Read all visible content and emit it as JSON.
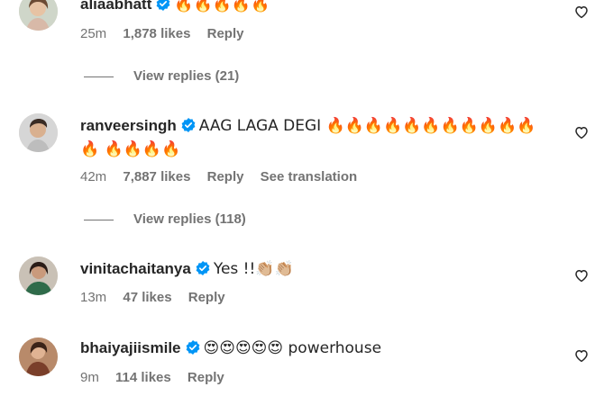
{
  "comments": [
    {
      "username": "aliaabhatt",
      "text": "🔥🔥🔥🔥🔥",
      "time": "25m",
      "likes": "1,878 likes",
      "reply": "Reply",
      "view_replies": "View replies (21)"
    },
    {
      "username": "ranveersingh",
      "text": "AAG LAGA DEGI 🔥🔥🔥🔥🔥🔥🔥🔥🔥🔥🔥🔥 🔥🔥🔥🔥",
      "time": "42m",
      "likes": "7,887 likes",
      "reply": "Reply",
      "translation": "See translation",
      "view_replies": "View replies (118)"
    },
    {
      "username": "vinitachaitanya",
      "text": "Yes !!👏🏼👏🏼",
      "time": "13m",
      "likes": "47 likes",
      "reply": "Reply"
    },
    {
      "username": "bhaiyajiismile",
      "text": "😍😍😍😍😍 powerhouse",
      "time": "9m",
      "likes": "114 likes",
      "reply": "Reply"
    }
  ],
  "icons": {
    "verified": "verified-badge-icon",
    "like": "heart-outline-icon"
  },
  "colors": {
    "verified": "#0095f6",
    "secondary_text": "#737373",
    "primary_text": "#262626"
  }
}
